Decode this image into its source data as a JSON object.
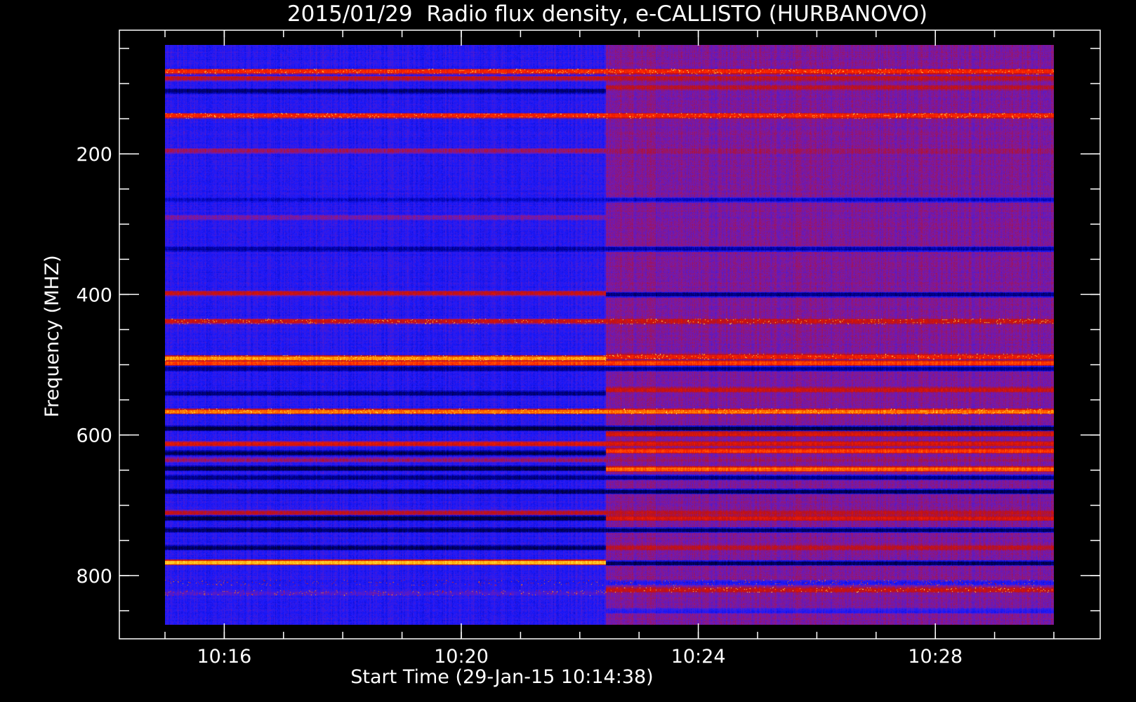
{
  "chart_data": {
    "type": "heatmap",
    "title": "2015/01/29  Radio flux density, e-CALLISTO (HURBANOVO)",
    "xlabel": "Start Time (29-Jan-15 10:14:38)",
    "ylabel": "Frequency (MHZ)",
    "x_range": [
      "10:15:00",
      "10:30:00"
    ],
    "y_range_mhz": [
      45,
      870
    ],
    "y_axis_inverted": true,
    "x_ticks": [
      "10:16",
      "10:20",
      "10:24",
      "10:28"
    ],
    "x_tick_minutes": [
      16,
      20,
      24,
      28
    ],
    "x_minor_tick_minutes": [
      15,
      16,
      17,
      18,
      19,
      20,
      21,
      22,
      23,
      24,
      25,
      26,
      27,
      28,
      29,
      30
    ],
    "y_ticks": [
      200,
      400,
      600,
      800
    ],
    "y_minor_ticks": [
      50,
      100,
      150,
      200,
      250,
      300,
      350,
      400,
      450,
      500,
      550,
      600,
      650,
      700,
      750,
      800,
      850
    ],
    "segment_break_time": "10:22:26",
    "colormap": [
      "#000030",
      "#0000a0",
      "#1a1aff",
      "#7a1aa8",
      "#c01010",
      "#ff2000",
      "#ffa000",
      "#ffff60"
    ],
    "background_level": 0.3,
    "second_segment_background_level": 0.44,
    "bands": [
      {
        "freq_mhz": 82,
        "level": 0.7,
        "sparkle": true
      },
      {
        "freq_mhz": 92,
        "level": 0.55
      },
      {
        "freq_mhz": 110,
        "level": 0.1
      },
      {
        "freq_mhz": 145,
        "level": 0.7,
        "sparkle": true
      },
      {
        "freq_mhz": 195,
        "level": 0.5
      },
      {
        "freq_mhz": 265,
        "level": 0.2
      },
      {
        "freq_mhz": 290,
        "level": 0.42
      },
      {
        "freq_mhz": 335,
        "level": 0.15
      },
      {
        "freq_mhz": 398,
        "level": 0.58
      },
      {
        "freq_mhz": 438,
        "level": 0.6,
        "sparkle": true
      },
      {
        "freq_mhz": 490,
        "level": 0.85,
        "sparkle": true
      },
      {
        "freq_mhz": 497,
        "level": 0.75
      },
      {
        "freq_mhz": 505,
        "level": 0.12
      },
      {
        "freq_mhz": 540,
        "level": 0.1
      },
      {
        "freq_mhz": 566,
        "level": 0.8,
        "sparkle": true
      },
      {
        "freq_mhz": 590,
        "level": 0.02
      },
      {
        "freq_mhz": 612,
        "level": 0.62
      },
      {
        "freq_mhz": 625,
        "level": 0.05
      },
      {
        "freq_mhz": 635,
        "level": 0.48
      },
      {
        "freq_mhz": 647,
        "level": 0.02
      },
      {
        "freq_mhz": 660,
        "level": 0.1
      },
      {
        "freq_mhz": 680,
        "level": 0.05
      },
      {
        "freq_mhz": 710,
        "level": 0.55
      },
      {
        "freq_mhz": 718,
        "level": 0.02
      },
      {
        "freq_mhz": 735,
        "level": 0.08
      },
      {
        "freq_mhz": 760,
        "level": 0.06
      },
      {
        "freq_mhz": 781,
        "level": 0.9
      },
      {
        "freq_mhz": 810,
        "level": 0.28,
        "sparkle": true
      },
      {
        "freq_mhz": 825,
        "level": 0.35,
        "sparkle": true
      },
      {
        "freq_mhz": 850,
        "level": 0.3
      }
    ],
    "second_segment_bands": [
      {
        "freq_mhz": 105,
        "level": 0.55
      },
      {
        "freq_mhz": 400,
        "level": 0.1
      },
      {
        "freq_mhz": 488,
        "level": 0.68,
        "sparkle": true
      },
      {
        "freq_mhz": 535,
        "level": 0.6
      },
      {
        "freq_mhz": 566,
        "level": 0.8,
        "sparkle": true
      },
      {
        "freq_mhz": 598,
        "level": 0.62
      },
      {
        "freq_mhz": 622,
        "level": 0.72
      },
      {
        "freq_mhz": 648,
        "level": 0.78
      },
      {
        "freq_mhz": 718,
        "level": 0.62
      },
      {
        "freq_mhz": 760,
        "level": 0.55
      },
      {
        "freq_mhz": 782,
        "level": 0.06
      },
      {
        "freq_mhz": 820,
        "level": 0.58,
        "sparkle": true
      }
    ]
  }
}
